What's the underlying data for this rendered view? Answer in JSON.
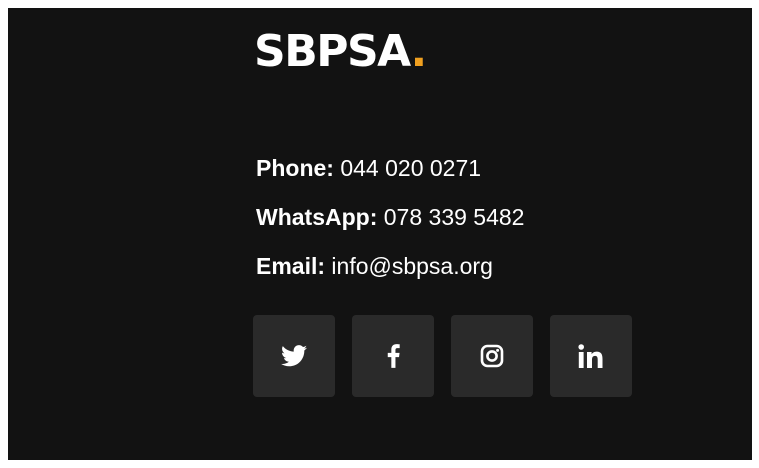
{
  "brand": {
    "name": "SBPSA",
    "dot": ".",
    "accent_color": "#f0a020"
  },
  "contact": {
    "phone_label": "Phone:",
    "phone_value": "044 020 0271",
    "whatsapp_label": "WhatsApp:",
    "whatsapp_value": "078 339 5482",
    "email_label": "Email:",
    "email_value": "info@sbpsa.org"
  },
  "social": {
    "button_color": "#2a2a2a",
    "icons": [
      "twitter-icon",
      "facebook-icon",
      "instagram-icon",
      "linkedin-icon"
    ]
  },
  "colors": {
    "background": "#121212",
    "text": "#ffffff"
  }
}
